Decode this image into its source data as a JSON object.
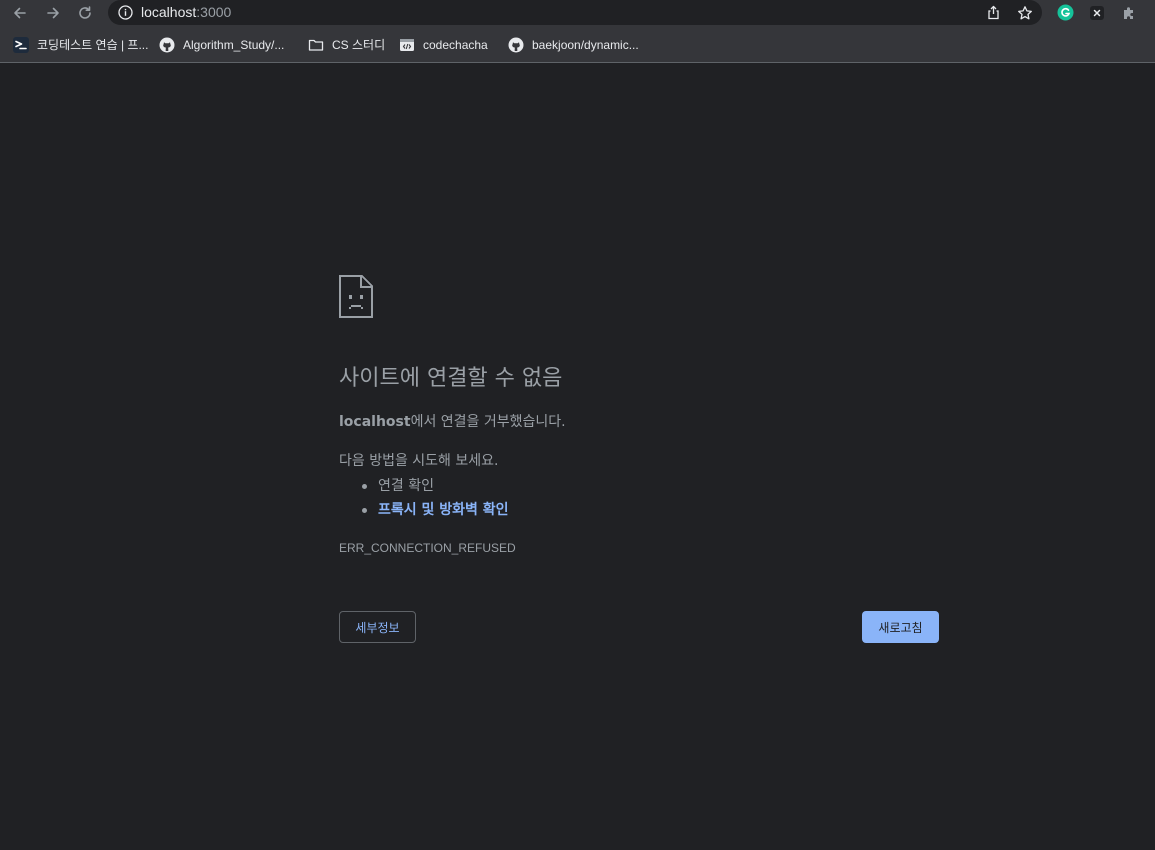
{
  "browser": {
    "url_host": "localhost",
    "url_port": ":3000"
  },
  "bookmarks": [
    {
      "label": "코딩테스트 연습 | 프...",
      "icon": "programmers-icon"
    },
    {
      "label": "Algorithm_Study/...",
      "icon": "github-icon"
    },
    {
      "label": "CS 스터디",
      "icon": "folder-icon"
    },
    {
      "label": "codechacha",
      "icon": "code-icon"
    },
    {
      "label": "baekjoon/dynamic...",
      "icon": "github-icon"
    }
  ],
  "error": {
    "title": "사이트에 연결할 수 없음",
    "host": "localhost",
    "summary_suffix": "에서 연결을 거부했습니다.",
    "try_heading": "다음 방법을 시도해 보세요.",
    "suggestions": [
      "연결 확인",
      "프록시 및 방화벽 확인"
    ],
    "code": "ERR_CONNECTION_REFUSED",
    "details_button": "세부정보",
    "reload_button": "새로고침"
  },
  "colors": {
    "background": "#202124",
    "toolbar": "#35363a",
    "text": "#9aa0a6",
    "link": "#8ab4f8",
    "grammarly": "#15c39a"
  }
}
